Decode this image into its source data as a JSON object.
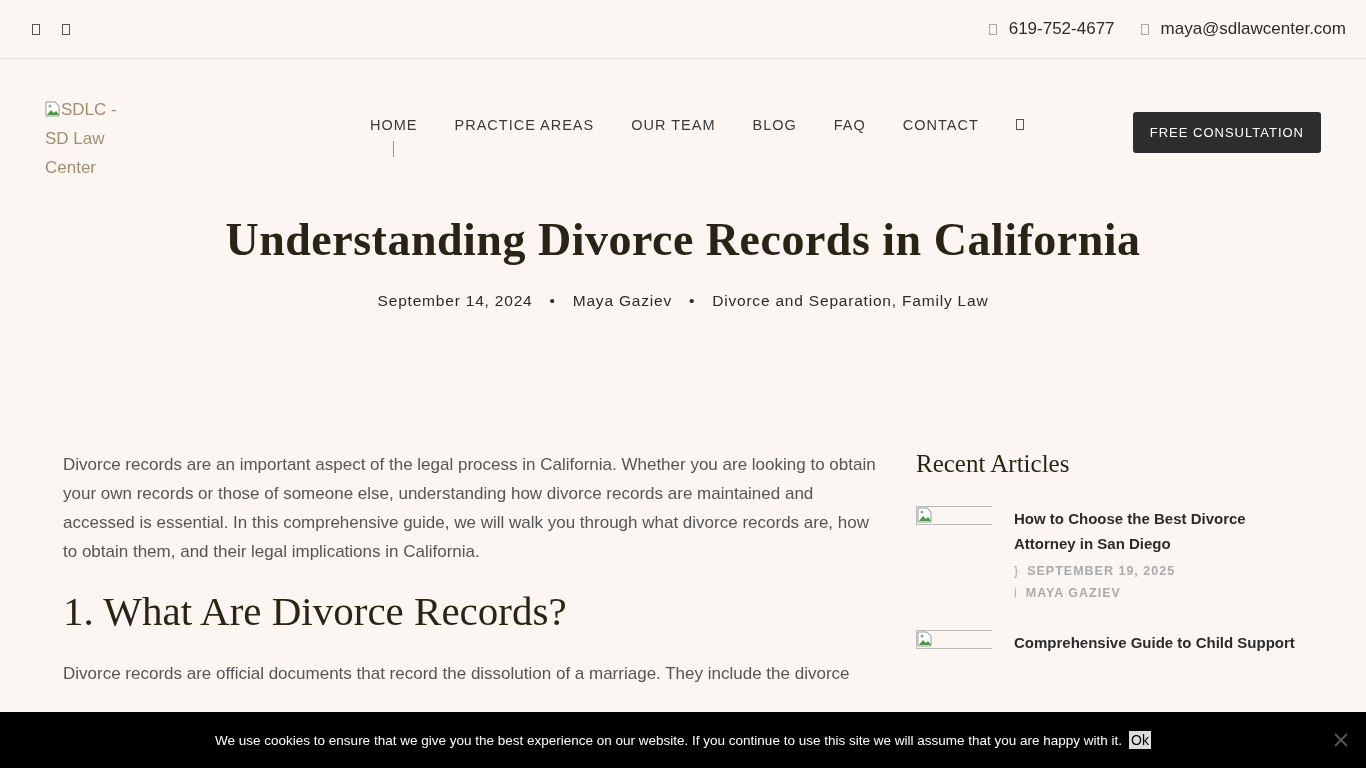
{
  "top_bar": {
    "phone": "619-752-4677",
    "email": "maya@sdlawcenter.com"
  },
  "header": {
    "logo_alt": "SDLC - SD Law Center",
    "nav": [
      {
        "label": "HOME",
        "selected": true
      },
      {
        "label": "PRACTICE AREAS",
        "selected": false
      },
      {
        "label": "OUR TEAM",
        "selected": false
      },
      {
        "label": "BLOG",
        "selected": false
      },
      {
        "label": "FAQ",
        "selected": false
      },
      {
        "label": "CONTACT",
        "selected": false
      }
    ],
    "cta": "FREE CONSULTATION"
  },
  "post": {
    "title": "Understanding Divorce Records in California",
    "date": "September 14, 2024",
    "separator": "•",
    "author": "Maya Gaziev",
    "categories": "Divorce and Separation, Family Law"
  },
  "content": [
    {
      "kind": "paragraph",
      "text": "Divorce records are an important aspect of the legal process in California. Whether you are looking to obtain your own records or those of someone else, understanding how divorce records are maintained and accessed is essential. In this comprehensive guide, we will walk you through what divorce records are, how to obtain them, and their legal implications in California."
    },
    {
      "kind": "heading",
      "text": "1. What Are Divorce Records?"
    },
    {
      "kind": "paragraph",
      "text": "Divorce records are official documents that record the dissolution of a marriage. They include the divorce"
    }
  ],
  "sidebar": {
    "title": "Recent Articles",
    "articles": [
      {
        "title": "How to Choose the Best Divorce Attorney in San Diego",
        "date_icon": "}",
        "date": "SEPTEMBER 19, 2025",
        "author_icon": "i",
        "author": "MAYA GAZIEV"
      },
      {
        "title": "Comprehensive Guide to Child Support"
      }
    ]
  },
  "cookie_bar": {
    "text": "We use cookies to ensure that we give you the best experience on our website. If you continue to use this site we will assume that you are happy with it.",
    "button": "Ok"
  }
}
